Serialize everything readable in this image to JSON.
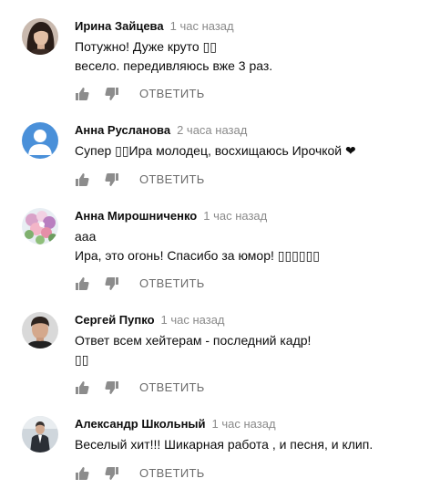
{
  "comments": [
    {
      "author": "Ирина Зайцева",
      "time": "1 час назад",
      "text": "Потужно! Дуже круто ▯▯\nвесело. передивляюсь вже 3 раз.",
      "avatar": "photo-woman-dark-hair-avatar",
      "actions": {
        "like_icon": "thumbs-up-icon",
        "dislike_icon": "thumbs-down-icon",
        "reply_label": "ОТВЕТИТЬ"
      }
    },
    {
      "author": "Анна Русланова",
      "time": "2 часа назад",
      "text": "Супер ▯▯Ира молодец, восхищаюсь Ирочкой ❤",
      "avatar": "default-user-avatar",
      "actions": {
        "like_icon": "thumbs-up-icon",
        "dislike_icon": "thumbs-down-icon",
        "reply_label": "ОТВЕТИТЬ"
      }
    },
    {
      "author": "Анна Мирошниченко",
      "time": "1 час назад",
      "text": "ааа\nИра, это огонь! Спасибо за юмор! ▯▯▯▯▯▯",
      "avatar": "flowers-bouquet-avatar",
      "actions": {
        "like_icon": "thumbs-up-icon",
        "dislike_icon": "thumbs-down-icon",
        "reply_label": "ОТВЕТИТЬ"
      }
    },
    {
      "author": "Сергей Пупко",
      "time": "1 час назад",
      "text": "Ответ всем хейтерам - последний кадр!\n▯▯",
      "avatar": "photo-man-portrait-avatar",
      "actions": {
        "like_icon": "thumbs-up-icon",
        "dislike_icon": "thumbs-down-icon",
        "reply_label": "ОТВЕТИТЬ"
      }
    },
    {
      "author": "Александр Школьный",
      "time": "1 час назад",
      "text": "Веселый хит!!! Шикарная работа , и песня, и клип.",
      "avatar": "photo-man-suit-avatar",
      "actions": {
        "like_icon": "thumbs-up-icon",
        "dislike_icon": "thumbs-down-icon",
        "reply_label": "ОТВЕТИТЬ"
      }
    }
  ],
  "colors": {
    "author": "#0d0d0d",
    "time": "#8a8a8a",
    "action": "#6b6b6b",
    "default_avatar": "#4a90d9"
  }
}
